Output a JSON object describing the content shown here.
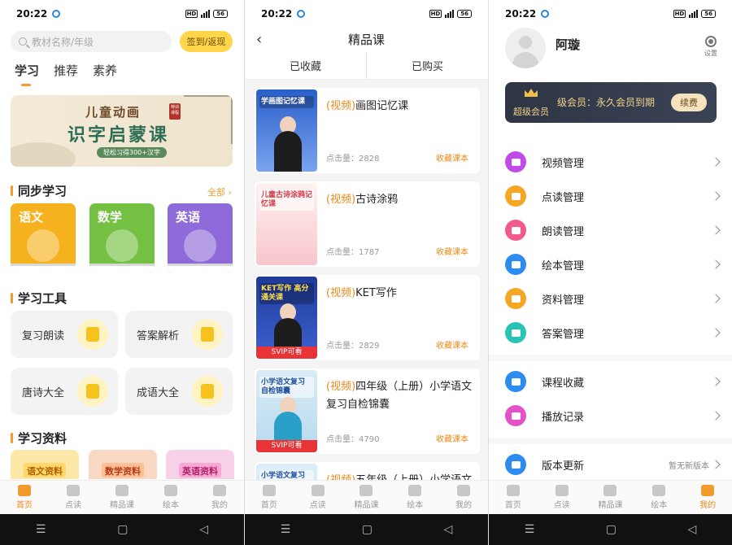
{
  "status": {
    "time": "20:22",
    "hd": "HD",
    "network": "5G",
    "battery": "56"
  },
  "panel1": {
    "search_placeholder": "教材名称/年级",
    "sign_button": "签到/返现",
    "tabs": [
      {
        "label": "学习",
        "active": true
      },
      {
        "label": "推荐",
        "active": false
      },
      {
        "label": "素养",
        "active": false
      }
    ],
    "banner": {
      "line1": "儿童动画",
      "tag": "特训 课程",
      "line2": "识字启蒙课",
      "line3": "轻松习得300+汉字"
    },
    "sync_title": "同步学习",
    "sync_all": "全部 ›",
    "books": [
      {
        "label": "语文"
      },
      {
        "label": "数学"
      },
      {
        "label": "英语"
      }
    ],
    "tools_title": "学习工具",
    "tools": [
      {
        "label": "复习朗读",
        "icon": "book-read-icon"
      },
      {
        "label": "答案解析",
        "icon": "answer-sheet-icon"
      },
      {
        "label": "唐诗大全",
        "icon": "poem-book-icon"
      },
      {
        "label": "成语大全",
        "icon": "graduation-cap-icon"
      }
    ],
    "materials_title": "学习资料",
    "materials": [
      {
        "label": "语文资料"
      },
      {
        "label": "数学资料"
      },
      {
        "label": "英语资料"
      }
    ],
    "nav": [
      {
        "label": "首页",
        "active": true
      },
      {
        "label": "点读",
        "active": false
      },
      {
        "label": "精品课",
        "active": false
      },
      {
        "label": "绘本",
        "active": false
      },
      {
        "label": "我的",
        "active": false
      }
    ]
  },
  "panel2": {
    "title": "精品课",
    "back_label": "‹",
    "subtabs": [
      "已收藏",
      "已购买"
    ],
    "courses": [
      {
        "prefix": "(视频)",
        "title": "画图记忆课",
        "clicks_label": "点击量：2828",
        "fav": "收藏课本",
        "thumb_text": "学画图记忆课",
        "svip": ""
      },
      {
        "prefix": "(视频)",
        "title": "古诗涂鸦",
        "clicks_label": "点击量：1787",
        "fav": "收藏课本",
        "thumb_text": "儿童古诗涂鸦记忆课",
        "svip": ""
      },
      {
        "prefix": "(视频)",
        "title": "KET写作",
        "clicks_label": "点击量：2829",
        "fav": "收藏课本",
        "thumb_text": "KET写作 高分通关课",
        "svip": "SVIP可看"
      },
      {
        "prefix": "(视频)",
        "title": "四年级（上册）小学语文复习自检锦囊",
        "clicks_label": "点击量：4790",
        "fav": "收藏课本",
        "thumb_text": "小学语文复习 自检锦囊",
        "svip": "SVIP可看"
      },
      {
        "prefix": "(视频)",
        "title": "五年级（上册）小学语文复习自检锦囊",
        "clicks_label": "",
        "fav": "",
        "thumb_text": "小学语文复习 自检锦囊",
        "svip": ""
      }
    ],
    "nav": [
      {
        "label": "首页",
        "active": false
      },
      {
        "label": "点读",
        "active": false
      },
      {
        "label": "精品课",
        "active": false
      },
      {
        "label": "绘本",
        "active": false
      },
      {
        "label": "我的",
        "active": false
      }
    ]
  },
  "panel3": {
    "username": "阿璇",
    "settings_label": "设置",
    "vip": {
      "badge": "超级会员",
      "text": "级会员：永久会员到期",
      "renew": "续费"
    },
    "menu_group1": [
      {
        "label": "视频管理",
        "icon": "video-icon",
        "color": "#c14be8"
      },
      {
        "label": "点读管理",
        "icon": "finger-point-icon",
        "color": "#f5a623"
      },
      {
        "label": "朗读管理",
        "icon": "headphones-icon",
        "color": "#f25a8c"
      },
      {
        "label": "绘本管理",
        "icon": "picture-book-icon",
        "color": "#2d8cf0"
      },
      {
        "label": "资料管理",
        "icon": "document-icon",
        "color": "#f5a623"
      },
      {
        "label": "答案管理",
        "icon": "answer-icon",
        "color": "#27c4b4"
      }
    ],
    "menu_group2": [
      {
        "label": "课程收藏",
        "icon": "star-icon",
        "color": "#2d8cf0"
      },
      {
        "label": "播放记录",
        "icon": "footprint-icon",
        "color": "#e352c8"
      }
    ],
    "menu_group3": [
      {
        "label": "版本更新",
        "icon": "download-icon",
        "color": "#2d8cf0",
        "note": "暂无新版本"
      }
    ],
    "nav": [
      {
        "label": "首页",
        "active": false
      },
      {
        "label": "点读",
        "active": false
      },
      {
        "label": "精品课",
        "active": false
      },
      {
        "label": "绘本",
        "active": false
      },
      {
        "label": "我的",
        "active": true
      }
    ]
  },
  "sysbar": {
    "menu": "☰",
    "home": "▢",
    "back": "◁"
  }
}
